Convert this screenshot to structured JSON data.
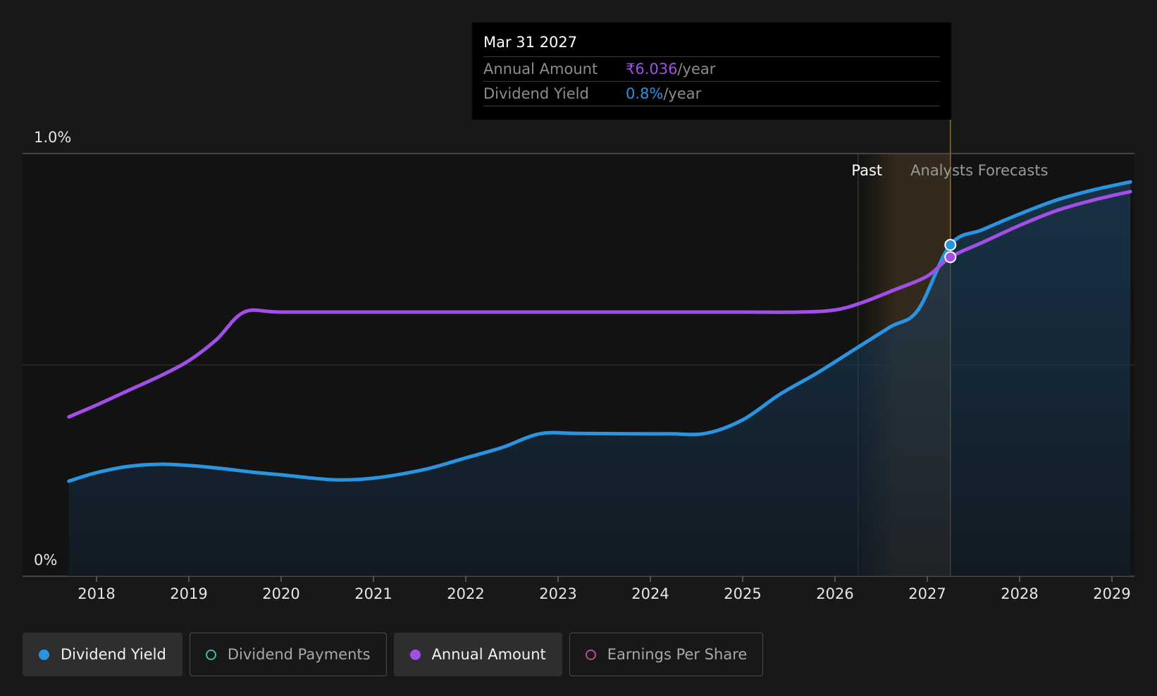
{
  "chart_data": {
    "type": "line",
    "x_range": [
      2017.3,
      2029.2
    ],
    "y_range": [
      0,
      1.0
    ],
    "y_ticks": [
      {
        "value": 1.0,
        "label": "1.0%"
      },
      {
        "value": 0,
        "label": "0%"
      }
    ],
    "x_ticks": [
      "2018",
      "2019",
      "2020",
      "2021",
      "2022",
      "2023",
      "2024",
      "2025",
      "2026",
      "2027",
      "2028",
      "2029"
    ],
    "past_label": "Past",
    "forecast_label": "Analysts Forecasts",
    "past_start": 2026.25,
    "forecast_start": 2026.65,
    "cursor_x": 2027.25,
    "series": [
      {
        "name": "Dividend Yield",
        "color": "#2b94e0",
        "area": true,
        "points": [
          [
            2017.7,
            0.225
          ],
          [
            2018.0,
            0.245
          ],
          [
            2018.35,
            0.26
          ],
          [
            2018.7,
            0.265
          ],
          [
            2019.0,
            0.262
          ],
          [
            2019.35,
            0.255
          ],
          [
            2019.7,
            0.246
          ],
          [
            2020.0,
            0.24
          ],
          [
            2020.3,
            0.233
          ],
          [
            2020.6,
            0.228
          ],
          [
            2020.9,
            0.23
          ],
          [
            2021.2,
            0.238
          ],
          [
            2021.6,
            0.255
          ],
          [
            2022.0,
            0.28
          ],
          [
            2022.4,
            0.305
          ],
          [
            2022.8,
            0.337
          ],
          [
            2023.2,
            0.338
          ],
          [
            2023.8,
            0.337
          ],
          [
            2024.2,
            0.337
          ],
          [
            2024.6,
            0.338
          ],
          [
            2025.0,
            0.37
          ],
          [
            2025.4,
            0.43
          ],
          [
            2025.8,
            0.48
          ],
          [
            2026.2,
            0.535
          ],
          [
            2026.6,
            0.59
          ],
          [
            2026.9,
            0.63
          ],
          [
            2027.25,
            0.784
          ],
          [
            2027.6,
            0.82
          ],
          [
            2028.0,
            0.857
          ],
          [
            2028.4,
            0.89
          ],
          [
            2028.8,
            0.914
          ],
          [
            2029.2,
            0.933
          ]
        ]
      },
      {
        "name": "Annual Amount",
        "color": "#a24fe6",
        "area": false,
        "points": [
          [
            2017.7,
            0.377
          ],
          [
            2018.0,
            0.405
          ],
          [
            2018.35,
            0.44
          ],
          [
            2018.7,
            0.475
          ],
          [
            2019.0,
            0.51
          ],
          [
            2019.3,
            0.56
          ],
          [
            2019.6,
            0.625
          ],
          [
            2020.0,
            0.625
          ],
          [
            2021.0,
            0.625
          ],
          [
            2022.0,
            0.625
          ],
          [
            2023.0,
            0.625
          ],
          [
            2024.0,
            0.625
          ],
          [
            2025.0,
            0.625
          ],
          [
            2025.6,
            0.625
          ],
          [
            2026.0,
            0.63
          ],
          [
            2026.3,
            0.648
          ],
          [
            2026.65,
            0.678
          ],
          [
            2027.0,
            0.71
          ],
          [
            2027.25,
            0.755
          ],
          [
            2027.6,
            0.79
          ],
          [
            2028.0,
            0.83
          ],
          [
            2028.4,
            0.865
          ],
          [
            2028.8,
            0.89
          ],
          [
            2029.2,
            0.91
          ]
        ]
      }
    ]
  },
  "tooltip": {
    "date": "Mar 31 2027",
    "rows": [
      {
        "label": "Annual Amount",
        "value": "₹6.036",
        "unit": "/year"
      },
      {
        "label": "Dividend Yield",
        "value": "0.8%",
        "unit": "/year"
      }
    ]
  },
  "legend": [
    {
      "label": "Dividend Yield",
      "color": "#2b94e0",
      "active": true
    },
    {
      "label": "Dividend Payments",
      "color": "#3fb8a8",
      "active": false
    },
    {
      "label": "Annual Amount",
      "color": "#a24fe6",
      "active": true
    },
    {
      "label": "Earnings Per Share",
      "color": "#c04a8a",
      "active": false
    }
  ]
}
